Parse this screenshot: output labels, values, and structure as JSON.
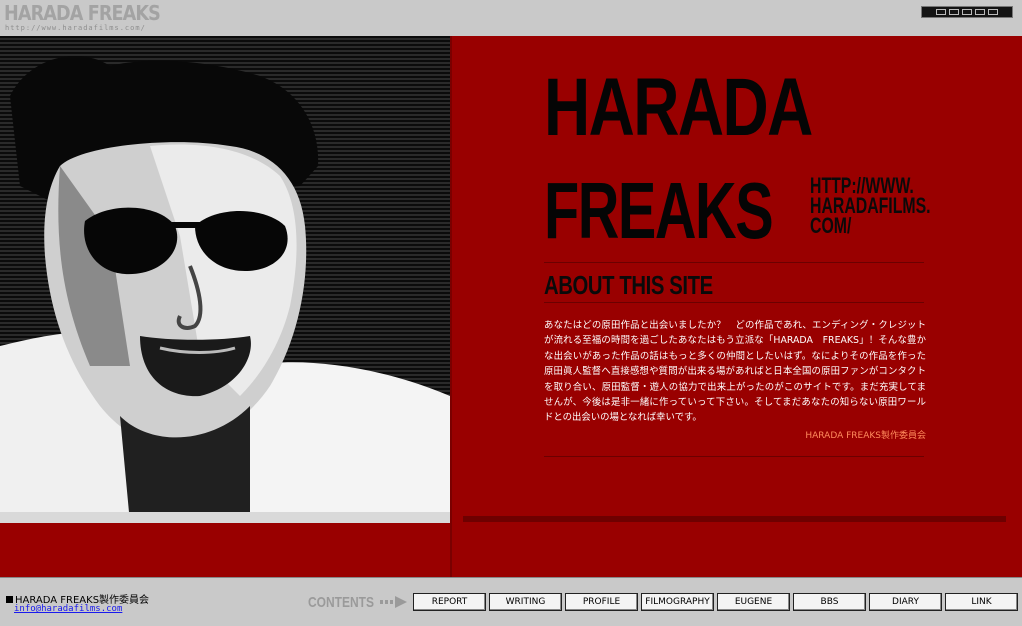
{
  "header": {
    "logo": "HARADA FREAKS",
    "logo_url": "http://www.haradafilms.com/"
  },
  "hero": {
    "title_line1": "HARADA",
    "title_line2": "FREAKS",
    "url_lines": [
      "HTTP://WWW.",
      "HARADAFILMS.",
      "COM/"
    ],
    "section_title": "ABOUT THIS SITE",
    "body": "あなたはどの原田作品と出会いましたか？　どの作品であれ、エンディング・クレジットが流れる至福の時間を過ごしたあなたはもう立派な「HARADA　FREAKS」！そんな豊かな出会いがあった作品の話はもっと多くの仲間としたいはず。なによりその作品を作った原田眞人監督へ直接感想や質問が出来る場があればと日本全国の原田ファンがコンタクトを取り合い、原田監督・遊人の協力で出来上がったのがこのサイトです。まだ充実してませんが、今後は是非一緒に作っていって下さい。そしてまだあなたの知らない原田ワールドとの出会いの場となれば幸いです。",
    "signature": "HARADA FREAKS製作委員会"
  },
  "footer": {
    "org": "HARADA FREAKS製作委員会",
    "email": "info@haradafilms.com",
    "contents_label": "CONTENTS",
    "nav": [
      "REPORT",
      "WRITING",
      "PROFILE",
      "FILMOGRAPHY",
      "EUGENE",
      "BBS",
      "DIARY",
      "LINK"
    ]
  },
  "colors": {
    "background": "#c9c9c9",
    "panel_red": "#990000",
    "signature": "#ff8a5c",
    "link": "#1a1aee"
  },
  "icons": [
    "badge-icon",
    "arrow-right-icon",
    "square-bullet-icon"
  ]
}
